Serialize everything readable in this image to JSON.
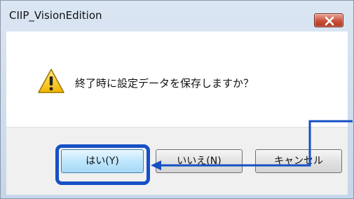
{
  "window": {
    "title": "CIIP_VisionEdition"
  },
  "dialog": {
    "message": "終了時に設定データを保存しますか？",
    "icon": "warning-icon"
  },
  "buttons": {
    "yes": "はい(Y)",
    "no": "いいえ(N)",
    "cancel": "キャンセル"
  },
  "colors": {
    "annotation": "#1550c6",
    "close_button": "#c9503b"
  }
}
